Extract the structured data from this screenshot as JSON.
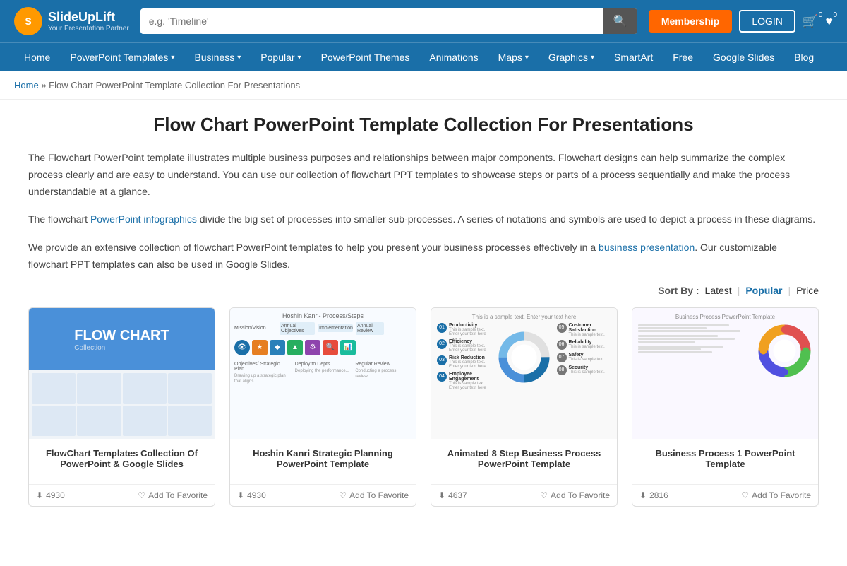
{
  "header": {
    "logo_brand": "SlideUpLift",
    "logo_tagline": "Your Presentation Partner",
    "search_placeholder": "e.g. 'Timeline'",
    "membership_label": "Membership",
    "login_label": "LOGIN",
    "cart_count": "0",
    "wishlist_count": "0"
  },
  "nav": {
    "items": [
      {
        "label": "Home",
        "has_arrow": false
      },
      {
        "label": "PowerPoint Templates",
        "has_arrow": true
      },
      {
        "label": "Business",
        "has_arrow": true
      },
      {
        "label": "Popular",
        "has_arrow": true
      },
      {
        "label": "PowerPoint Themes",
        "has_arrow": false
      },
      {
        "label": "Animations",
        "has_arrow": false
      },
      {
        "label": "Maps",
        "has_arrow": true
      },
      {
        "label": "Graphics",
        "has_arrow": true
      },
      {
        "label": "SmartArt",
        "has_arrow": false
      },
      {
        "label": "Free",
        "has_arrow": false
      },
      {
        "label": "Google Slides",
        "has_arrow": false
      },
      {
        "label": "Blog",
        "has_arrow": false
      }
    ]
  },
  "breadcrumb": {
    "home_label": "Home",
    "separator": "»",
    "current": "Flow Chart PowerPoint Template Collection For Presentations"
  },
  "page": {
    "title": "Flow Chart PowerPoint Template Collection For Presentations",
    "description1": "The Flowchart PowerPoint template illustrates multiple business purposes and relationships between major components. Flowchart designs can help summarize the complex process clearly and are easy to understand. You can use our collection of flowchart PPT templates to showcase steps or parts of a process sequentially and make the process understandable at a glance.",
    "description2_pre": "The flowchart ",
    "description2_link": "PowerPoint infographics",
    "description2_post": " divide the big set of processes into smaller sub-processes. A series of notations and symbols are used to depict a process in these diagrams.",
    "description3_pre": "We provide an extensive collection of flowchart PowerPoint templates to help you present your business processes effectively in a ",
    "description3_link": "business presentation",
    "description3_post": ". Our customizable flowchart PPT templates can also be used in Google Slides."
  },
  "sort": {
    "label": "Sort By :",
    "options": [
      "Latest",
      "Popular",
      "Price"
    ],
    "active": "Popular"
  },
  "products": [
    {
      "id": 1,
      "title": "FlowChart Templates Collection Of PowerPoint & Google Slides",
      "downloads": "4930",
      "favorite_label": "Add To Favorite",
      "thumb_type": "flowchart"
    },
    {
      "id": 2,
      "title": "Hoshin Kanri Strategic Planning PowerPoint Template",
      "downloads": "4930",
      "favorite_label": "Add To Favorite",
      "thumb_type": "hoshin"
    },
    {
      "id": 3,
      "title": "Animated 8 Step Business Process PowerPoint Template",
      "downloads": "4637",
      "favorite_label": "Add To Favorite",
      "thumb_type": "animated"
    },
    {
      "id": 4,
      "title": "Business Process 1 PowerPoint Template",
      "downloads": "2816",
      "favorite_label": "Add To Favorite",
      "thumb_type": "business"
    }
  ]
}
